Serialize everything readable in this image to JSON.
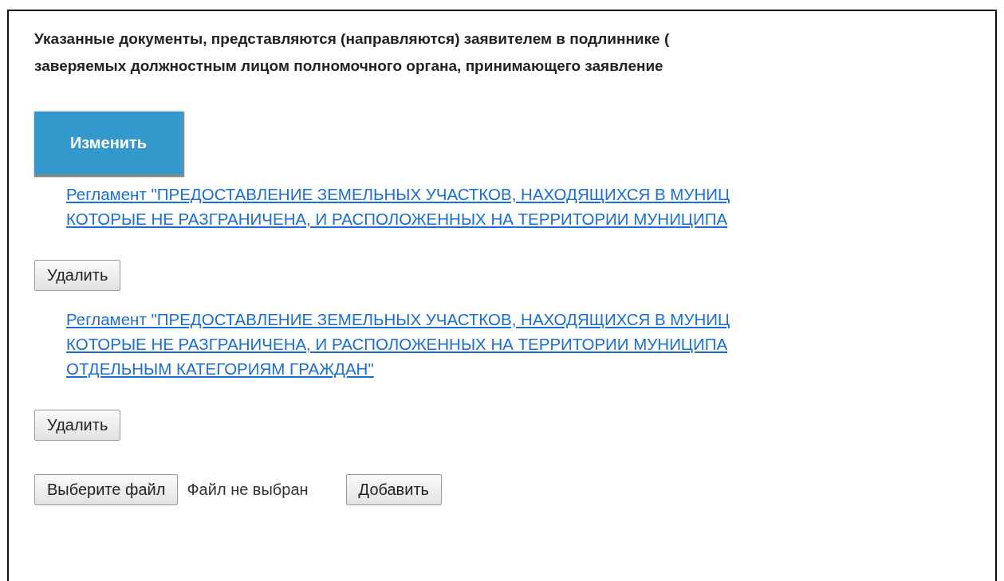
{
  "notice": {
    "lines": [
      "Указанные документы, представляются (направляются) заявителем в подлиннике (",
      "заверяемых должностным лицом полномочного органа, принимающего заявление"
    ]
  },
  "change_button": "Изменить",
  "documents": [
    {
      "link_lines": [
        "Регламент \"ПРЕДОСТАВЛЕНИЕ ЗЕМЕЛЬНЫХ УЧАСТКОВ, НАХОДЯЩИХСЯ В МУНИЦ",
        "КОТОРЫЕ НЕ РАЗГРАНИЧЕНА, И РАСПОЛОЖЕННЫХ НА ТЕРРИТОРИИ МУНИЦИПА"
      ],
      "delete_button": "Удалить"
    },
    {
      "link_lines": [
        "Регламент \"ПРЕДОСТАВЛЕНИЕ ЗЕМЕЛЬНЫХ УЧАСТКОВ, НАХОДЯЩИХСЯ В МУНИЦ",
        "КОТОРЫЕ НЕ РАЗГРАНИЧЕНА, И РАСПОЛОЖЕННЫХ НА ТЕРРИТОРИИ МУНИЦИПА",
        "ОТДЕЛЬНЫМ КАТЕГОРИЯМ ГРАЖДАН\""
      ],
      "delete_button": "Удалить"
    }
  ],
  "file_input": {
    "button": "Выберите файл",
    "status": "Файл не выбран"
  },
  "add_button": "Добавить"
}
